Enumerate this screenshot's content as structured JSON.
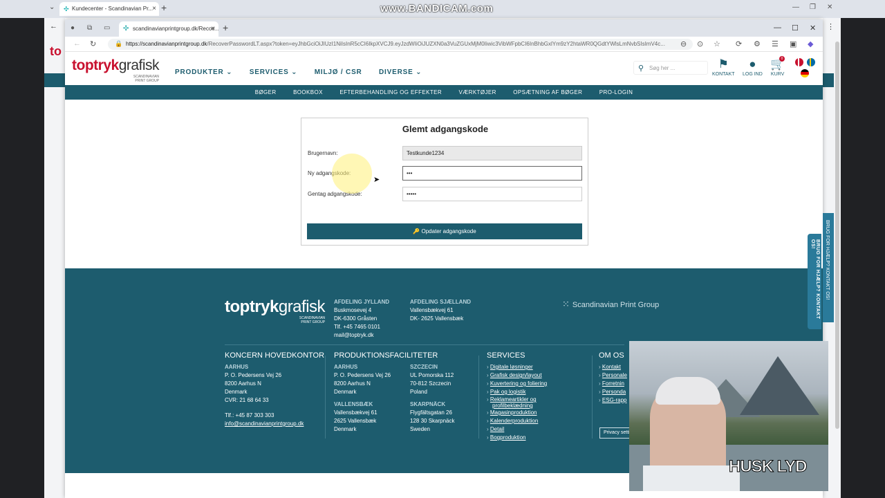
{
  "watermark": "www.BANDICAM.com",
  "outer_browser": {
    "tab_title": "Kundecenter - Scandinavian Pr..."
  },
  "browser": {
    "tab_title": "scandinavianprintgroup.dk/Recov...",
    "url_host": "https://scandinavianprintgroup.dk",
    "url_path": "/RecoverPasswordLT.aspx?token=eyJhbGciOiJIUzI1NiIsInR5cCI6IkpXVCJ9.eyJzdWIiOiJUZXN0a3VuZGUxMjM0Iiwic3VibWFpbCI6InBhbGxlYm9zY2htaWR0QGdtYWlsLmNvbSIsImV4c..."
  },
  "header": {
    "logo_a": "toptryk",
    "logo_b": "grafisk",
    "logo_sub1": "SCANDINAVIAN",
    "logo_sub2": "PRINT GROUP",
    "nav": [
      {
        "label": "PRODUKTER ⌄"
      },
      {
        "label": "SERVICES ⌄"
      },
      {
        "label": "MILJØ / CSR"
      },
      {
        "label": "DIVERSE ⌄"
      }
    ],
    "search_placeholder": "Søg her ...",
    "kontakt": "KONTAKT",
    "log_ind": "LOG IND",
    "kurv": "KURV",
    "cart_count": "0"
  },
  "subnav": [
    "BØGER",
    "BOOKBOX",
    "EFTERBEHANDLING OG EFFEKTER",
    "VÆRKTØJER",
    "OPSÆTNING AF BØGER",
    "PRO-LOGIN"
  ],
  "form": {
    "title": "Glemt adgangskode",
    "username_label": "Brugernavn:",
    "username_value": "Testkunde1234",
    "new_password_label": "Ny adgangskode:",
    "new_password_value": "•••",
    "repeat_password_label": "Gentag adgangskode:",
    "repeat_password_value": "•••••",
    "submit_label": "🔑 Opdater adgangskode"
  },
  "footer": {
    "logo_a": "toptryk",
    "logo_b": "grafisk",
    "logo_sub1": "SCANDINAVIAN",
    "logo_sub2": "PRINT GROUP",
    "jylland": {
      "heading": "AFDELING JYLLAND",
      "line1": "Buskmosevej 4",
      "line2": "DK-6300 Gråsten",
      "line3": "Tlf. +45 7465 0101",
      "email": "mail@toptryk.dk"
    },
    "sjaelland": {
      "heading": "AFDELING SJÆLLAND",
      "line1": "Vallensbækvej 61",
      "line2": "DK- 2625 Vallensbæk"
    },
    "sgp": "Scandinavian Print Group",
    "koncern": {
      "title": "KONCERN HOVEDKONTOR",
      "city": "AARHUS",
      "line1": "P. O. Pedersens Vej 26",
      "line2": "8200 Aarhus N",
      "line3": "Denmark",
      "cvr": "CVR: 21 68 64 33",
      "tlf": "Tlf.: +45 87 303 303",
      "email": "info@scandinavianprintgroup.dk"
    },
    "produktion": {
      "title": "PRODUKTIONSFACILITETER",
      "aarhus": {
        "city": "AARHUS",
        "line1": "P. O. Pedersens Vej 26",
        "line2": "8200 Aarhus N",
        "line3": "Denmark"
      },
      "szczecin": {
        "city": "SZCZECIN",
        "line1": "UL Pomorska 112",
        "line2": "70-812 Szczecin",
        "line3": "Poland"
      },
      "vallensbaek": {
        "city": "VALLENSBÆK",
        "line1": "Vallensbækvej 61",
        "line2": "2625 Vallensbæk",
        "line3": "Denmark"
      },
      "skarpnack": {
        "city": "SKARPNÄCK",
        "line1": "Flygfältsgatan 26",
        "line2": "128 30 Skarpnäck",
        "line3": "Sweden"
      }
    },
    "services": {
      "title": "SERVICES",
      "items": [
        "Digitale løsninger",
        "Grafisk design/layout",
        "Kuvertering og foliering",
        "Pak og logistik",
        "Reklameartikler og",
        "profilbeklædning",
        "Magasinproduktion",
        "Kalenderproduktion",
        "Detail",
        "Bogproduktion"
      ]
    },
    "om_os": {
      "title": "OM OS",
      "items": [
        "Kontakt",
        "Personale",
        "Forretnin",
        "Personda",
        "ESG-rapp"
      ],
      "privacy": "Privacy setti"
    }
  },
  "help_tab": "BRUG FOR HJÆLP? KONTAKT OS!",
  "webcam_caption": "HUSK LYD"
}
